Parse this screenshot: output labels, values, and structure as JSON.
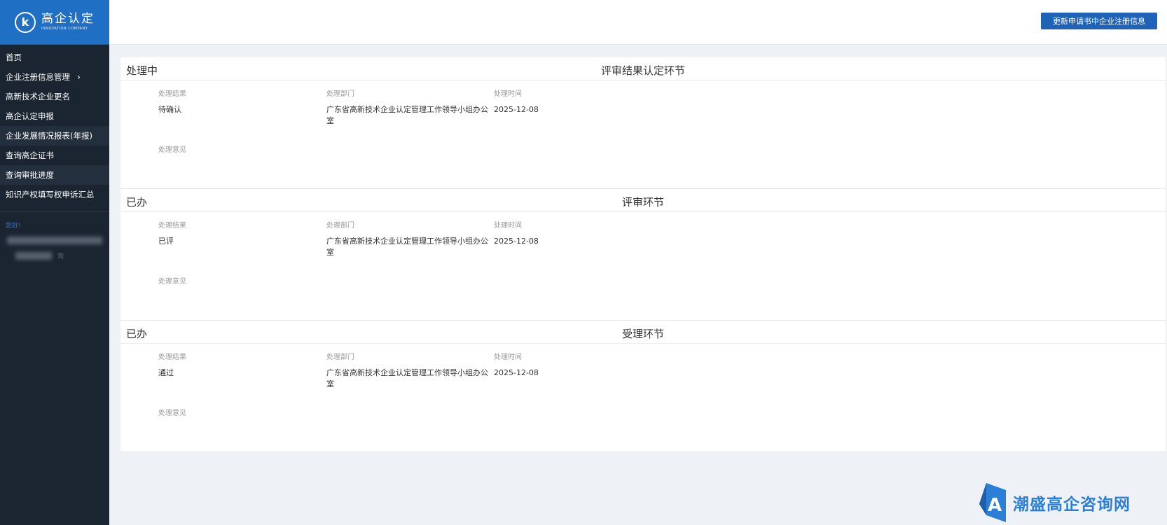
{
  "brand": {
    "title": "高企认定",
    "subtitle": "INNOVATION COMPANY"
  },
  "sidebar": {
    "items": [
      {
        "label": "首页"
      },
      {
        "label": "企业注册信息管理"
      },
      {
        "label": "高新技术企业更名"
      },
      {
        "label": "高企认定申报"
      },
      {
        "label": "企业发展情况报表(年报)"
      },
      {
        "label": "查询高企证书"
      },
      {
        "label": "查询审批进度"
      },
      {
        "label": "知识产权填写权申诉汇总"
      }
    ],
    "user_label": "您好!",
    "user_suffix": "司"
  },
  "toolbar": {
    "update_label": "更新申请书中企业注册信息"
  },
  "field_labels": {
    "result": "处理结果",
    "dept": "处理部门",
    "time": "处理时间",
    "opinion": "处理意见"
  },
  "cards": [
    {
      "status": "处理中",
      "stage": "评审结果认定环节",
      "result": "待确认",
      "dept": "广东省高新技术企业认定管理工作领导小组办公室",
      "time": "2025-12-08"
    },
    {
      "status": "已办",
      "stage": "评审环节",
      "result": "已评",
      "dept": "广东省高新技术企业认定管理工作领导小组办公室",
      "time": "2025-12-08"
    },
    {
      "status": "已办",
      "stage": "受理环节",
      "result": "通过",
      "dept": "广东省高新技术企业认定管理工作领导小组办公室",
      "time": "2025-12-08"
    }
  ],
  "watermark": {
    "text": "潮盛高企咨询网"
  },
  "colors": {
    "brand_blue": "#1f6fc4",
    "sidebar_bg": "#1b2532",
    "button_blue": "#1e63b8",
    "watermark_blue": "#2b7fd6"
  }
}
